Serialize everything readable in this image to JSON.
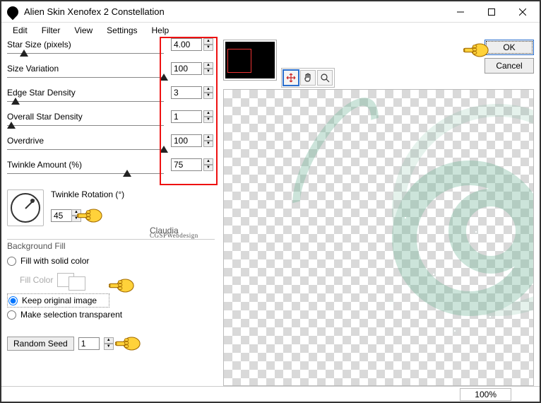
{
  "window": {
    "title": "Alien Skin Xenofex 2 Constellation"
  },
  "menu": {
    "edit": "Edit",
    "filter": "Filter",
    "view": "View",
    "settings": "Settings",
    "help": "Help"
  },
  "sliders": {
    "star_size": {
      "label": "Star Size (pixels)",
      "value": "4.00",
      "thumb_pct": 6
    },
    "size_variation": {
      "label": "Size Variation",
      "value": "100",
      "thumb_pct": 98
    },
    "edge_density": {
      "label": "Edge Star Density",
      "value": "3",
      "thumb_pct": 2
    },
    "overall_density": {
      "label": "Overall Star Density",
      "value": "1",
      "thumb_pct": 0
    },
    "overdrive": {
      "label": "Overdrive",
      "value": "100",
      "thumb_pct": 98
    },
    "twinkle_amount": {
      "label": "Twinkle Amount (%)",
      "value": "75",
      "thumb_pct": 74
    }
  },
  "twinkle_rotation": {
    "label": "Twinkle Rotation (°)",
    "value": "45"
  },
  "signature": {
    "name": "Claudia",
    "sub": "CGSPWebdesign"
  },
  "bgfill": {
    "title": "Background Fill",
    "fill_solid": "Fill with solid color",
    "fill_color_label": "Fill Color",
    "keep": "Keep original image",
    "transparent": "Make selection transparent",
    "selected": "keep"
  },
  "seed": {
    "button": "Random Seed",
    "value": "1"
  },
  "toolbar_icons": {
    "move": "move-icon",
    "hand": "hand-icon",
    "zoom": "zoom-icon"
  },
  "buttons": {
    "ok": "OK",
    "cancel": "Cancel"
  },
  "status": {
    "zoom": "100%"
  }
}
